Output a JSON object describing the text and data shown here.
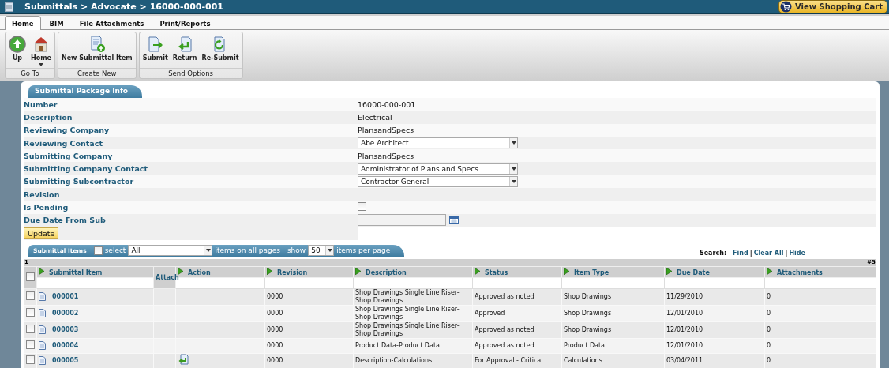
{
  "window": {
    "title": "Submittals > Advocate > 16000-000-001",
    "cart_button": "View Shopping Cart"
  },
  "tabs": [
    {
      "label": "Home",
      "selected": true
    },
    {
      "label": "BIM",
      "selected": false
    },
    {
      "label": "File Attachments",
      "selected": false
    },
    {
      "label": "Print/Reports",
      "selected": false
    }
  ],
  "ribbon": [
    {
      "label": "Go To",
      "buttons": [
        {
          "label": "Up",
          "kind": "up",
          "dropdown": false
        },
        {
          "label": "Home",
          "kind": "home",
          "dropdown": true
        }
      ]
    },
    {
      "label": "Create New",
      "buttons": [
        {
          "label": "New Submittal Item",
          "kind": "new",
          "dropdown": false
        }
      ]
    },
    {
      "label": "Send Options",
      "buttons": [
        {
          "label": "Submit",
          "kind": "submit",
          "dropdown": false
        },
        {
          "label": "Return",
          "kind": "return",
          "dropdown": false
        },
        {
          "label": "Re-Submit",
          "kind": "resubmit",
          "dropdown": false
        }
      ]
    }
  ],
  "package_info": {
    "title": "Submittal Package Info",
    "fields": [
      {
        "label": "Number",
        "kind": "text",
        "value": "16000-000-001"
      },
      {
        "label": "Description",
        "kind": "text",
        "value": "Electrical"
      },
      {
        "label": "Reviewing Company",
        "kind": "text",
        "value": "PlansandSpecs"
      },
      {
        "label": "Reviewing Contact",
        "kind": "select",
        "value": "Abe Architect"
      },
      {
        "label": "Submitting Company",
        "kind": "text",
        "value": "PlansandSpecs"
      },
      {
        "label": "Submitting Company Contact",
        "kind": "select",
        "value": "Administrator of Plans and Specs"
      },
      {
        "label": "Submitting Subcontractor",
        "kind": "select",
        "value": "Contractor General"
      },
      {
        "label": "Revision",
        "kind": "empty"
      },
      {
        "label": "Is Pending",
        "kind": "checkbox",
        "checked": false
      },
      {
        "label": "Due Date From Sub",
        "kind": "date"
      }
    ],
    "update_button": "Update"
  },
  "items": {
    "title": "Submittal Items",
    "select_all_checked": false,
    "select_label": "select",
    "select_value": "All",
    "scope_label": "items on all pages",
    "show_label": "show",
    "per_page": "50",
    "per_page_label": "items per page",
    "search_label": "Search:",
    "search_items": [
      {
        "kind": "link",
        "text": "Find"
      },
      {
        "kind": "separator",
        "text": "|"
      },
      {
        "kind": "link",
        "text": "Clear All"
      },
      {
        "kind": "separator",
        "text": "|"
      },
      {
        "kind": "link",
        "text": "Hide"
      }
    ],
    "page": "1",
    "count": "#5",
    "header_checked": false,
    "columns": [
      {
        "label": "Submittal Item",
        "sortable": true
      },
      {
        "label": "Attach",
        "sortable": false
      },
      {
        "label": "Action",
        "sortable": true
      },
      {
        "label": "Revision",
        "sortable": true
      },
      {
        "label": "Description",
        "sortable": true
      },
      {
        "label": "Status",
        "sortable": true
      },
      {
        "label": "Item Type",
        "sortable": true
      },
      {
        "label": "Due Date",
        "sortable": true
      },
      {
        "label": "Attachments",
        "sortable": true
      }
    ],
    "rows": [
      {
        "checked": false,
        "item": "000001",
        "action_icon": false,
        "revision": "0000",
        "description": "Shop Drawings Single Line Riser-Shop Drawings",
        "status": "Approved as noted",
        "item_type": "Shop Drawings",
        "due_date": "11/29/2010",
        "attachments": "0"
      },
      {
        "checked": false,
        "item": "000002",
        "action_icon": false,
        "revision": "0000",
        "description": "Shop Drawings Single Line Riser-Shop Drawings",
        "status": "Approved",
        "item_type": "Shop Drawings",
        "due_date": "12/01/2010",
        "attachments": "0"
      },
      {
        "checked": false,
        "item": "000003",
        "action_icon": false,
        "revision": "0000",
        "description": "Shop Drawings Single Line Riser-Shop Drawings",
        "status": "Approved as noted",
        "item_type": "Shop Drawings",
        "due_date": "12/01/2010",
        "attachments": "0"
      },
      {
        "checked": false,
        "item": "000004",
        "action_icon": false,
        "revision": "0000",
        "description": "Product Data-Product Data",
        "status": "Approved as noted",
        "item_type": "Product Data",
        "due_date": "12/01/2010",
        "attachments": "0"
      },
      {
        "checked": false,
        "item": "000005",
        "action_icon": true,
        "revision": "0000",
        "description": "Description-Calculations",
        "status": "For Approval - Critical",
        "item_type": "Calculations",
        "due_date": "03/04/2011",
        "attachments": "0"
      }
    ]
  }
}
